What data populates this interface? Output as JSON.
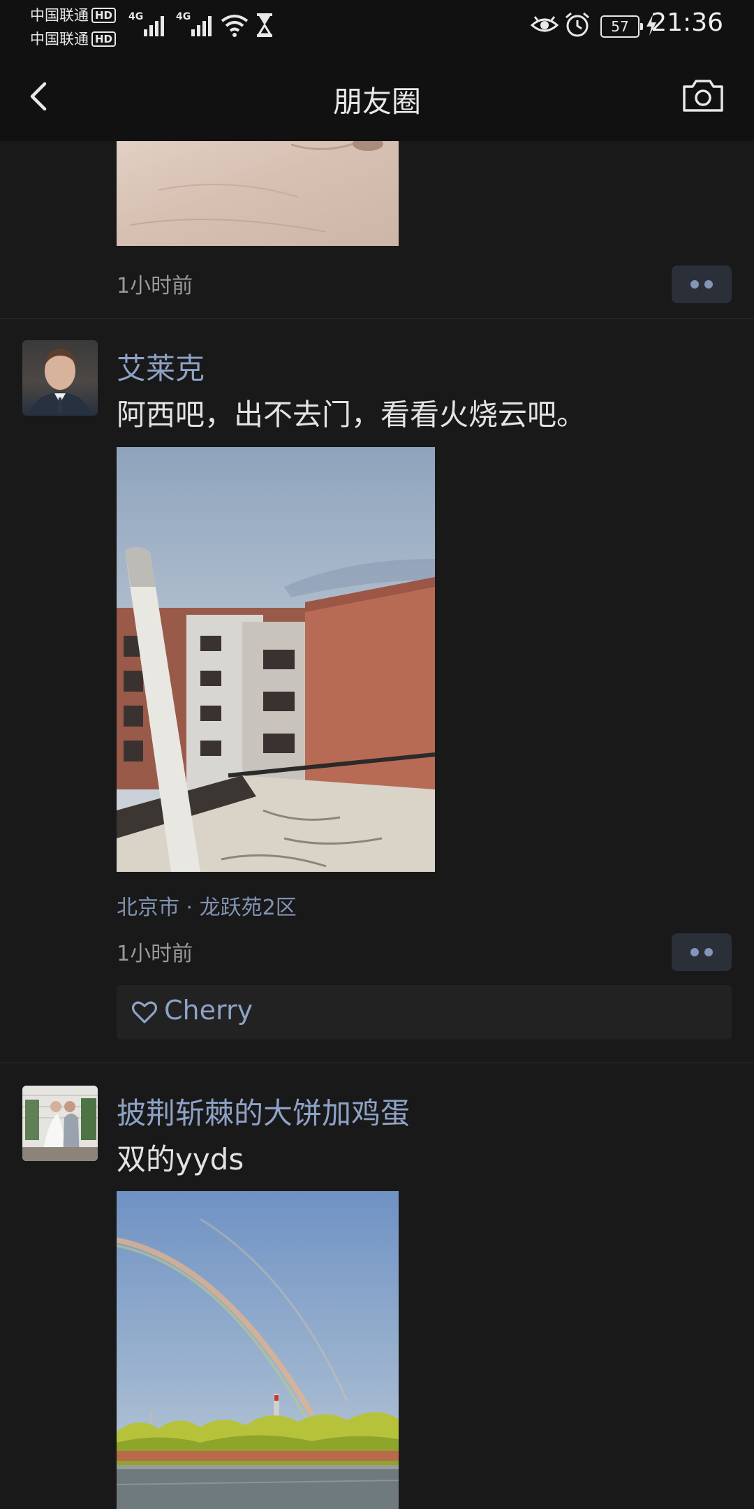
{
  "status_bar": {
    "carrier_1": "中国联通",
    "carrier_2": "中国联通",
    "hd": "HD",
    "network_1": "4G",
    "network_2": "4G",
    "battery": "57",
    "time": "21:36"
  },
  "nav": {
    "title": "朋友圈"
  },
  "feed": {
    "post_0": {
      "time": "1小时前"
    },
    "post_1": {
      "author": "艾莱克",
      "text": "阿西吧，出不去门，看看火烧云吧。",
      "location": "北京市 · 龙跃苑2区",
      "time": "1小时前",
      "likes": [
        "Cherry"
      ]
    },
    "post_2": {
      "author": "披荆斩棘的大饼加鸡蛋",
      "text": "双的yyds"
    }
  }
}
